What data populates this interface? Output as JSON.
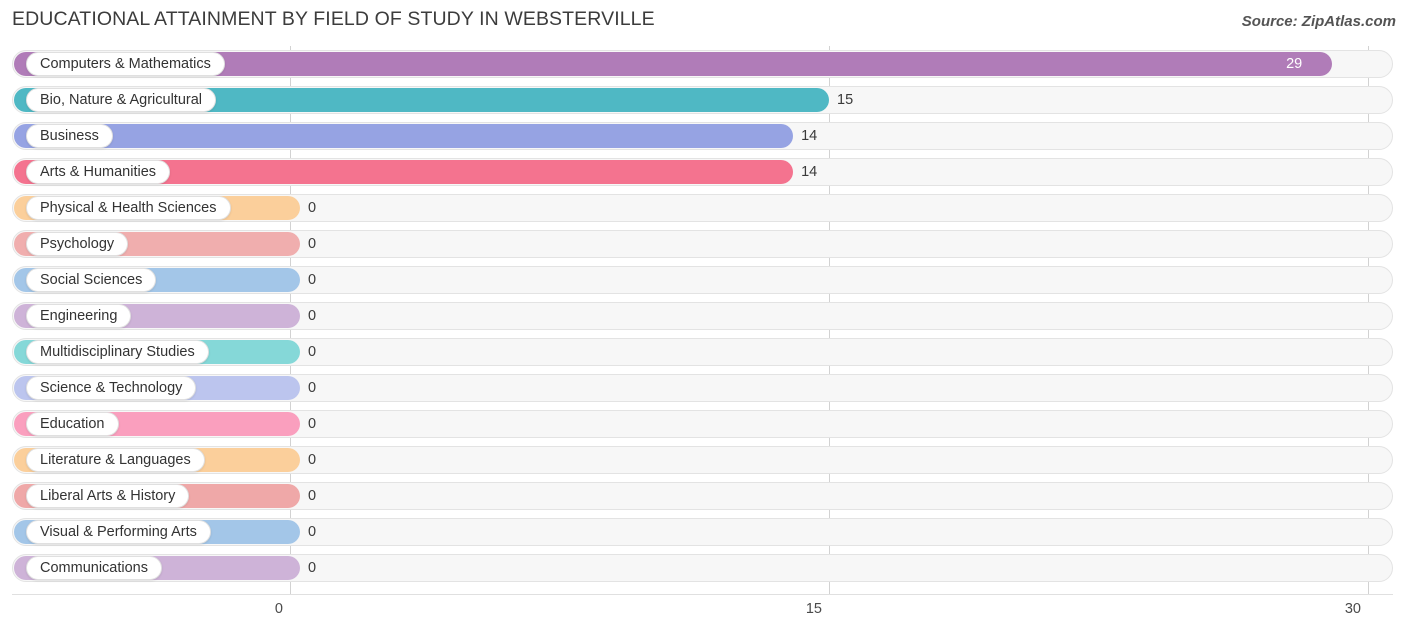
{
  "header": {
    "title": "EDUCATIONAL ATTAINMENT BY FIELD OF STUDY IN WEBSTERVILLE",
    "source": "Source: ZipAtlas.com"
  },
  "chart_data": {
    "type": "bar",
    "orientation": "horizontal",
    "title": "EDUCATIONAL ATTAINMENT BY FIELD OF STUDY IN WEBSTERVILLE",
    "xlabel": "",
    "ylabel": "",
    "xlim": [
      0,
      30
    ],
    "grid": true,
    "legend": "none",
    "xticks": [
      "0",
      "15",
      "30"
    ],
    "xtick_values": [
      0,
      15,
      30
    ],
    "categories": [
      "Computers & Mathematics",
      "Bio, Nature & Agricultural",
      "Business",
      "Arts & Humanities",
      "Physical & Health Sciences",
      "Psychology",
      "Social Sciences",
      "Engineering",
      "Multidisciplinary Studies",
      "Science & Technology",
      "Education",
      "Literature & Languages",
      "Liberal Arts & History",
      "Visual & Performing Arts",
      "Communications"
    ],
    "values": [
      29,
      15,
      14,
      14,
      0,
      0,
      0,
      0,
      0,
      0,
      0,
      0,
      0,
      0,
      0
    ],
    "value_labels": [
      "29",
      "15",
      "14",
      "14",
      "0",
      "0",
      "0",
      "0",
      "0",
      "0",
      "0",
      "0",
      "0",
      "0",
      "0"
    ],
    "colors": [
      "#b07cb8",
      "#4fb8c4",
      "#96a3e3",
      "#f4738f",
      "#fbcf9b",
      "#f0aeae",
      "#a3c6e8",
      "#ceb3d8",
      "#85d8d8",
      "#bcc5ee",
      "#fa9fbe",
      "#fbcf9b",
      "#efa8a8",
      "#a3c6e8",
      "#ceb3d8"
    ]
  }
}
